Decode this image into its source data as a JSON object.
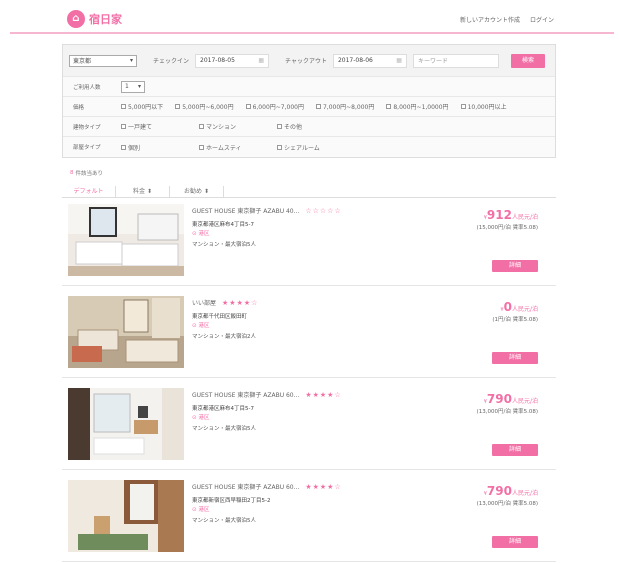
{
  "header": {
    "logo_text": "宿日家",
    "nav": [
      "新しいアカウント作成",
      "ログイン"
    ]
  },
  "search": {
    "area_value": "東京都",
    "checkin_label": "チェックイン",
    "checkin_value": "2017-08-05",
    "checkout_label": "チャックアウト",
    "checkout_value": "2017-08-06",
    "keyword_placeholder": "キーワード",
    "search_button": "検索",
    "guests_label": "ご利用人数",
    "guests_value": "1",
    "price_label": "価格",
    "price_options": [
      "5,000円以下",
      "5,000円~6,000円",
      "6,000円~7,000円",
      "7,000円~8,000円",
      "8,000円~1,0000円",
      "10,000円以上"
    ],
    "type_label": "建物タイプ",
    "type_options": [
      "一戸建て",
      "マンション",
      "その他"
    ],
    "room_label": "部屋タイプ",
    "room_options": [
      "個別",
      "ホームスティ",
      "シェアルーム"
    ]
  },
  "results": {
    "count": "8",
    "count_suffix": "件該当あり",
    "sort_tabs": [
      "デフォルト",
      "料金",
      "お勧め"
    ]
  },
  "listings": [
    {
      "title": "GUEST HOUSE 東京獅子 AZABU 40...",
      "stars": "☆☆☆☆☆",
      "address": "東京都港区麻布4丁目5-7",
      "area": "港区",
      "capacity": "マンション・最大宿泊5人",
      "price_prefix": "¥",
      "price": "912",
      "price_unit": "人民元/泊",
      "price_sub": "(15,000円/泊 賃率5.08)",
      "button": "詳細"
    },
    {
      "title": "いい部屋",
      "stars": "★★★★☆",
      "address": "東京都千代田区飯田町",
      "area": "港区",
      "capacity": "マンション・最大宿泊2人",
      "price_prefix": "¥",
      "price": "0",
      "price_unit": "人民元/泊",
      "price_sub": "(1円/泊 賃率5.08)",
      "button": "詳細"
    },
    {
      "title": "GUEST HOUSE 東京獅子 AZABU 60...",
      "stars": "★★★★☆",
      "address": "東京都港区麻布4丁目5-7",
      "area": "港区",
      "capacity": "マンション・最大宿泊5人",
      "price_prefix": "¥",
      "price": "790",
      "price_unit": "人民元/泊",
      "price_sub": "(13,000円/泊 賃率5.08)",
      "button": "詳細"
    },
    {
      "title": "GUEST HOUSE 東京獅子 AZABU 60...",
      "stars": "★★★★☆",
      "address": "東京都新宿区西早稲田2丁目5-2",
      "area": "港区",
      "capacity": "マンション・最大宿泊5人",
      "price_prefix": "¥",
      "price": "790",
      "price_unit": "人民元/泊",
      "price_sub": "(13,000円/泊 賃率5.08)",
      "button": "詳細"
    }
  ],
  "colors": {
    "accent": "#f26fa6",
    "divider": "#f7b6d0"
  }
}
